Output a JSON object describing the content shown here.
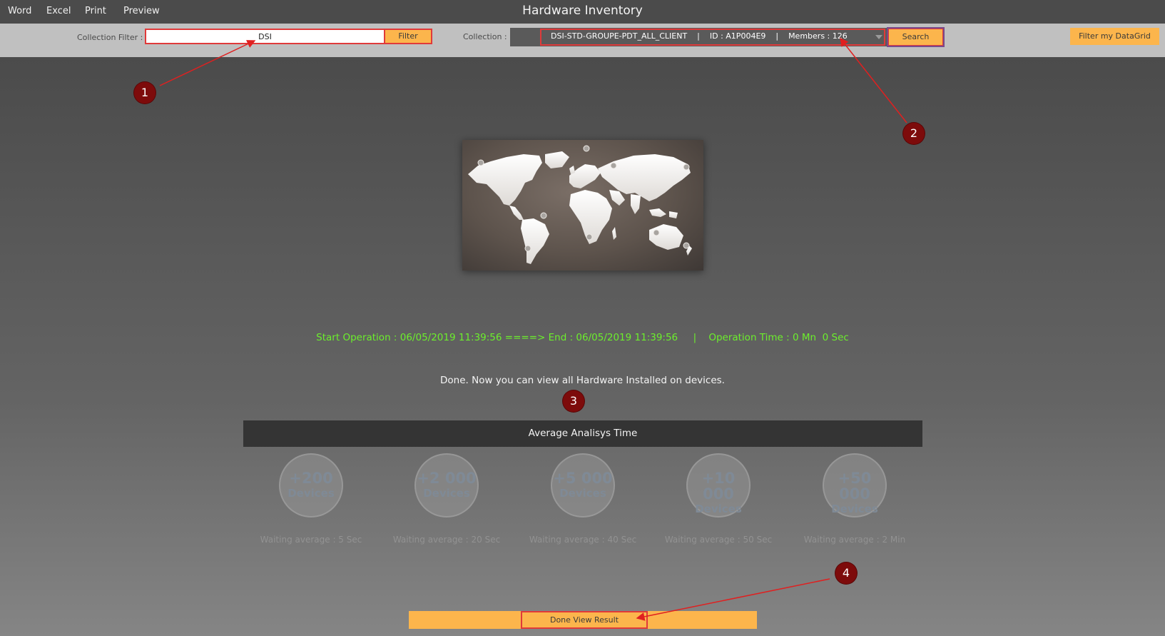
{
  "menu": {
    "word": "Word",
    "excel": "Excel",
    "print": "Print",
    "preview": "Preview"
  },
  "app": {
    "title": "Hardware Inventory"
  },
  "filter": {
    "label": "Collection Filter :",
    "value": "DSI",
    "button": "Filter"
  },
  "collection": {
    "label": "Collection :",
    "selected": "DSI-STD-GROUPE-PDT_ALL_CLIENT    |    ID : A1P004E9    |    Members : 126",
    "search_button": "Search"
  },
  "datagrid_button": "Filter my DataGrid",
  "markers": [
    "1",
    "2",
    "3",
    "4"
  ],
  "operation": "Start Operation : 06/05/2019 11:39:56 ====> End : 06/05/2019 11:39:56     |    Operation Time : 0 Mn  0 Sec",
  "done_message": "Done. Now you can view all Hardware Installed on devices.",
  "average": {
    "title": "Average Analisys Time",
    "stats": [
      {
        "count": "+200",
        "unit": "Devices",
        "wait": "Waiting average : 5 Sec"
      },
      {
        "count": "+2 000",
        "unit": "Devices",
        "wait": "Waiting average : 20 Sec"
      },
      {
        "count": "+5 000",
        "unit": "Devices",
        "wait": "Waiting average : 40 Sec"
      },
      {
        "count": "+10 000",
        "unit": "Devices",
        "wait": "Waiting average : 50 Sec"
      },
      {
        "count": "+50 000",
        "unit": "Devices",
        "wait": "Waiting average : 2 Min"
      }
    ]
  },
  "result_button": "Done View Result",
  "colors": {
    "accent": "#fcb54c",
    "highlight": "#e03a3a",
    "marker": "#7d0b0b",
    "operation_text": "#6cef2c"
  }
}
